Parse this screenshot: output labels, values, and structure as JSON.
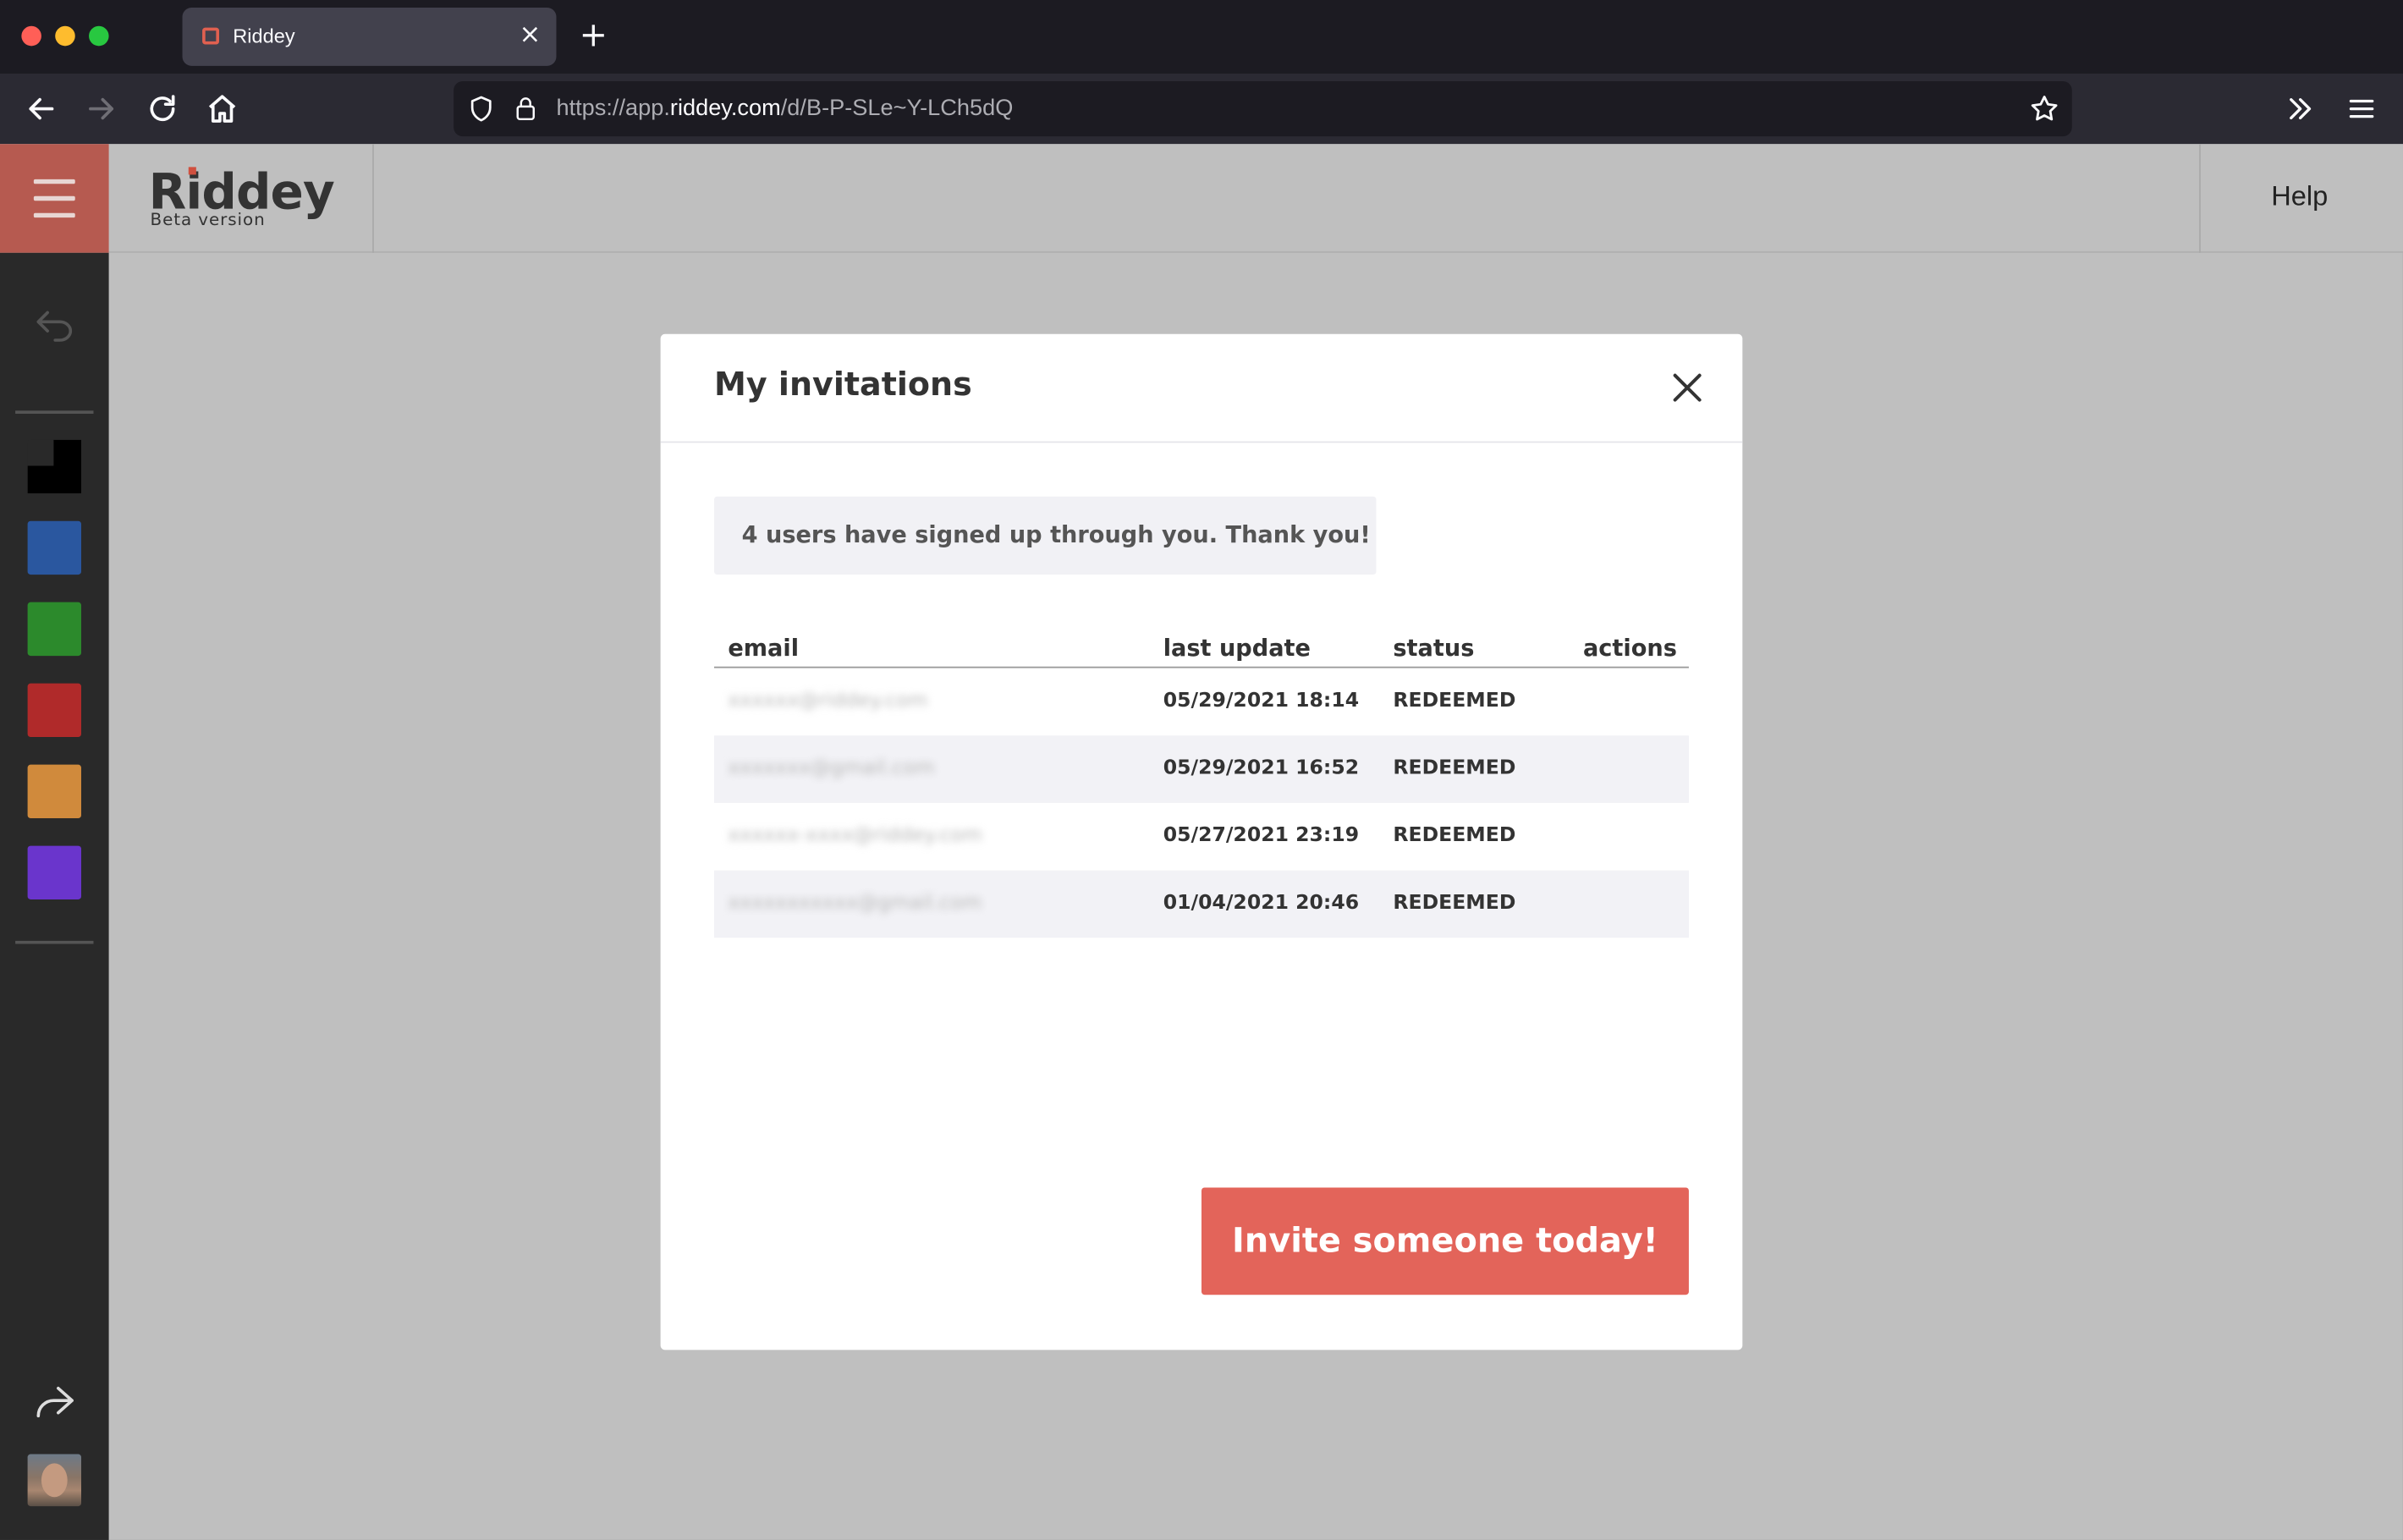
{
  "browser": {
    "tab": {
      "title": "Riddey",
      "favicon": "riddey-favicon"
    },
    "url": {
      "prefix": "https://app.",
      "domain": "riddey.com",
      "path": "/d/B-P-SLe~Y-LCh5dQ"
    },
    "traffic_colors": {
      "close": "#ff5f57",
      "minimize": "#febc2e",
      "maximize": "#28c840"
    }
  },
  "app": {
    "brand": {
      "name": "Riddey",
      "subtitle": "Beta version"
    },
    "help_label": "Help",
    "accent_color": "#e3645a",
    "palette": [
      {
        "name": "black",
        "color": "#000000"
      },
      {
        "name": "blue",
        "color": "#2a579f"
      },
      {
        "name": "green",
        "color": "#2c8a2c"
      },
      {
        "name": "red",
        "color": "#b02a2a"
      },
      {
        "name": "orange",
        "color": "#d08a3c"
      },
      {
        "name": "purple",
        "color": "#6a35cc"
      }
    ]
  },
  "modal": {
    "title": "My invitations",
    "notice": "4 users have signed up through you. Thank you!",
    "columns": {
      "email": "email",
      "last_update": "last update",
      "status": "status",
      "actions": "actions"
    },
    "rows": [
      {
        "email": "xxxxxx@riddey.com",
        "last_update": "05/29/2021 18:14",
        "status": "REDEEMED"
      },
      {
        "email": "xxxxxxx@gmail.com",
        "last_update": "05/29/2021 16:52",
        "status": "REDEEMED"
      },
      {
        "email": "xxxxxx-xxxx@riddey.com",
        "last_update": "05/27/2021 23:19",
        "status": "REDEEMED"
      },
      {
        "email": "xxxxxxxxxxx@gmail.com",
        "last_update": "01/04/2021 20:46",
        "status": "REDEEMED"
      }
    ],
    "invite_button": "Invite someone today!"
  }
}
